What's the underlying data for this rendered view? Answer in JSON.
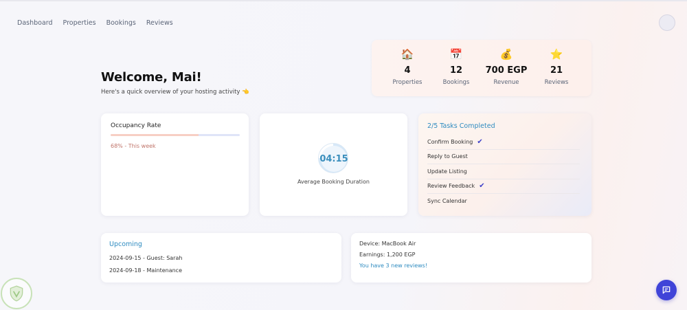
{
  "nav": {
    "items": [
      "Dashboard",
      "Properties",
      "Bookings",
      "Reviews"
    ]
  },
  "welcome": {
    "title": "Welcome, Mai!",
    "subtitle": "Here's a quick overview of your hosting activity 👈"
  },
  "stats": [
    {
      "icon": "🏠",
      "value": "4",
      "label": "Properties"
    },
    {
      "icon": "📅",
      "value": "12",
      "label": "Bookings"
    },
    {
      "icon": "💰",
      "value": "700 EGP",
      "label": "Revenue"
    },
    {
      "icon": "⭐",
      "value": "21",
      "label": "Reviews"
    }
  ],
  "occupancy": {
    "title": "Occupancy Rate",
    "percent": 68,
    "caption": "68% - This week",
    "fill_color": "#f7cfc4",
    "track_color": "#dfe4f8"
  },
  "duration": {
    "value": "04:15",
    "caption": "Average Booking Duration",
    "progress_fraction": 0.75,
    "ring_color": "#d6e8f8"
  },
  "tasks": {
    "title": "2/5 Tasks Completed",
    "items": [
      {
        "label": "Confirm Booking",
        "done": true
      },
      {
        "label": "Reply to Guest",
        "done": false
      },
      {
        "label": "Update Listing",
        "done": false
      },
      {
        "label": "Review Feedback",
        "done": true
      },
      {
        "label": "Sync Calendar",
        "done": false
      }
    ],
    "check_glyph": "✔"
  },
  "upcoming": {
    "title": "Upcoming",
    "items": [
      "2024-09-15 - Guest: Sarah",
      "2024-09-18 - Maintenance"
    ]
  },
  "device": {
    "device": "Device: MacBook Air",
    "earnings": "Earnings: 1,200 EGP",
    "reviews_link": "You have 3 new reviews!"
  },
  "colors": {
    "accent": "#2e8bc0",
    "chat_button": "#4044d8"
  }
}
